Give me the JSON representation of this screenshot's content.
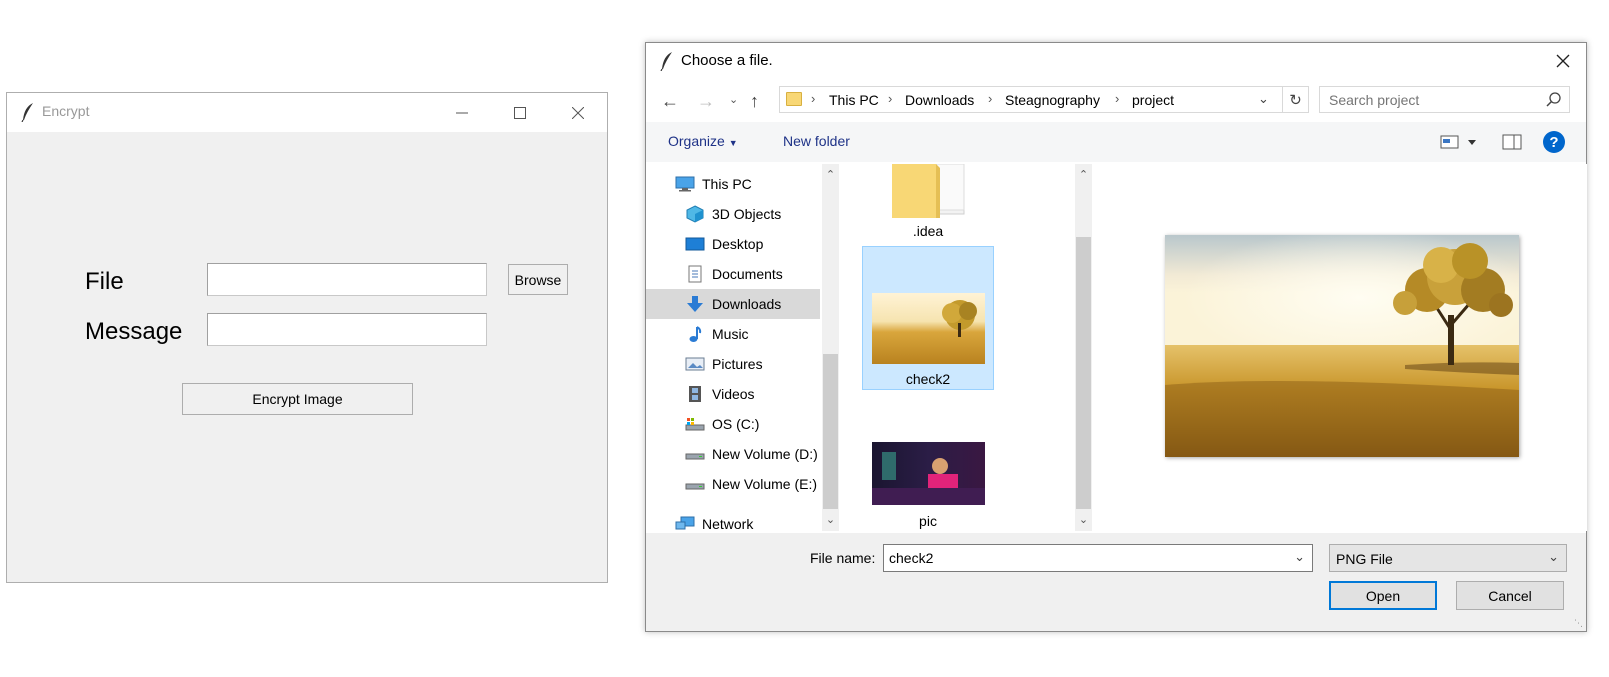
{
  "encrypt_window": {
    "title": "Encrypt",
    "file_label": "File",
    "message_label": "Message",
    "file_value": "",
    "message_value": "",
    "browse_label": "Browse",
    "encrypt_label": "Encrypt Image"
  },
  "dialog": {
    "title": "Choose a file.",
    "breadcrumbs": [
      "This PC",
      "Downloads",
      "Steagnography",
      "project"
    ],
    "search_placeholder": "Search project",
    "toolbar": {
      "organize_label": "Organize",
      "new_folder_label": "New folder"
    },
    "nav_items": [
      {
        "label": "This PC",
        "icon": "computer-icon"
      },
      {
        "label": "3D Objects",
        "icon": "cube-icon"
      },
      {
        "label": "Desktop",
        "icon": "desktop-icon"
      },
      {
        "label": "Documents",
        "icon": "document-icon"
      },
      {
        "label": "Downloads",
        "icon": "download-arrow-icon",
        "selected": true
      },
      {
        "label": "Music",
        "icon": "music-note-icon"
      },
      {
        "label": "Pictures",
        "icon": "pictures-icon"
      },
      {
        "label": "Videos",
        "icon": "film-icon"
      },
      {
        "label": "OS (C:)",
        "icon": "drive-os-icon"
      },
      {
        "label": "New Volume (D:)",
        "icon": "drive-icon"
      },
      {
        "label": "New Volume (E:)",
        "icon": "drive-icon"
      },
      {
        "label": "Network",
        "icon": "network-icon"
      }
    ],
    "files": [
      {
        "name": ".idea",
        "kind": "folder"
      },
      {
        "name": "check2",
        "kind": "image",
        "selected": true
      },
      {
        "name": "pic",
        "kind": "image"
      }
    ],
    "file_name_label": "File name:",
    "file_name_value": "check2",
    "file_type_value": "PNG File",
    "open_label": "Open",
    "cancel_label": "Cancel"
  },
  "colors": {
    "accent_link": "#1e3287",
    "selection_fill": "#cce8ff",
    "selection_border": "#99d1ff",
    "open_button_border": "#0078d7",
    "help_icon": "#0066cc"
  }
}
